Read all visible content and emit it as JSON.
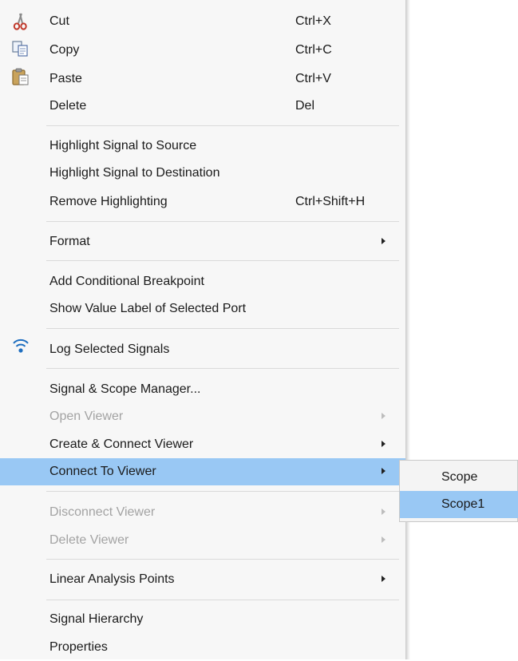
{
  "menu": {
    "items": [
      {
        "label": "Cut",
        "shortcut": "Ctrl+X",
        "icon": "scissors-icon"
      },
      {
        "label": "Copy",
        "shortcut": "Ctrl+C",
        "icon": "copy-icon"
      },
      {
        "label": "Paste",
        "shortcut": "Ctrl+V",
        "icon": "paste-icon"
      },
      {
        "label": "Delete",
        "shortcut": "Del"
      },
      {
        "label": "Highlight Signal to Source"
      },
      {
        "label": "Highlight Signal to Destination"
      },
      {
        "label": "Remove Highlighting",
        "shortcut": "Ctrl+Shift+H"
      },
      {
        "label": "Format",
        "submenu": true
      },
      {
        "label": "Add Conditional Breakpoint"
      },
      {
        "label": "Show Value Label of Selected Port"
      },
      {
        "label": "Log Selected Signals",
        "icon": "wifi-signal-icon"
      },
      {
        "label": "Signal & Scope Manager..."
      },
      {
        "label": "Open Viewer",
        "submenu": true,
        "disabled": true
      },
      {
        "label": "Create & Connect Viewer",
        "submenu": true
      },
      {
        "label": "Connect To Viewer",
        "submenu": true,
        "highlighted": true
      },
      {
        "label": "Disconnect Viewer",
        "submenu": true,
        "disabled": true
      },
      {
        "label": "Delete Viewer",
        "submenu": true,
        "disabled": true
      },
      {
        "label": "Linear Analysis Points",
        "submenu": true
      },
      {
        "label": "Signal Hierarchy"
      },
      {
        "label": "Properties"
      }
    ]
  },
  "submenu": {
    "items": [
      {
        "label": "Scope"
      },
      {
        "label": "Scope1",
        "highlighted": true
      }
    ]
  },
  "colors": {
    "highlight": "#99c8f4",
    "disabled_text": "#a3a3a3",
    "menu_background": "#f7f7f7"
  }
}
